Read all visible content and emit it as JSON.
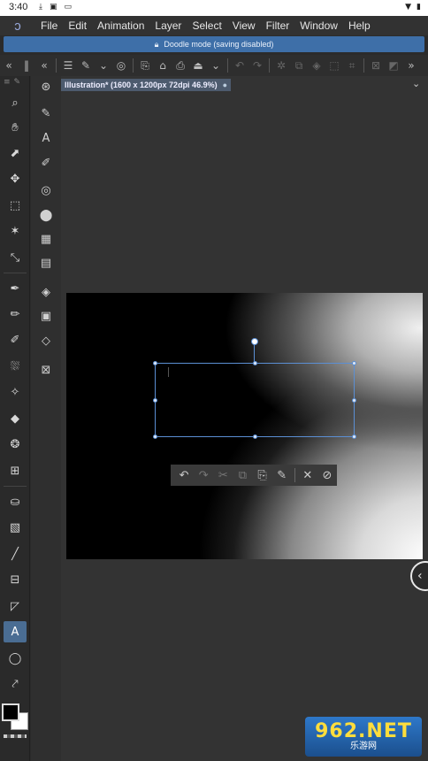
{
  "status_bar": {
    "time": "3:40",
    "left_icons": [
      "download-icon",
      "image-icon",
      "gallery-icon"
    ],
    "right_icons": [
      "wifi-icon",
      "battery-icon"
    ]
  },
  "menu": {
    "items": [
      "File",
      "Edit",
      "Animation",
      "Layer",
      "Select",
      "View",
      "Filter",
      "Window",
      "Help"
    ]
  },
  "doodle_banner": {
    "text": "Doodle mode (saving disabled)"
  },
  "document": {
    "tab_title": "Illustration* (1600 x 1200px 72dpi 46.9%)"
  },
  "colors": {
    "accent": "#3e6fa8",
    "selection": "#5b8fd4",
    "foreground": "#000000",
    "background": "#ffffff",
    "active_tool": "#4a6d93"
  },
  "watermark": {
    "main": "962.NET",
    "sub": "乐游网"
  }
}
